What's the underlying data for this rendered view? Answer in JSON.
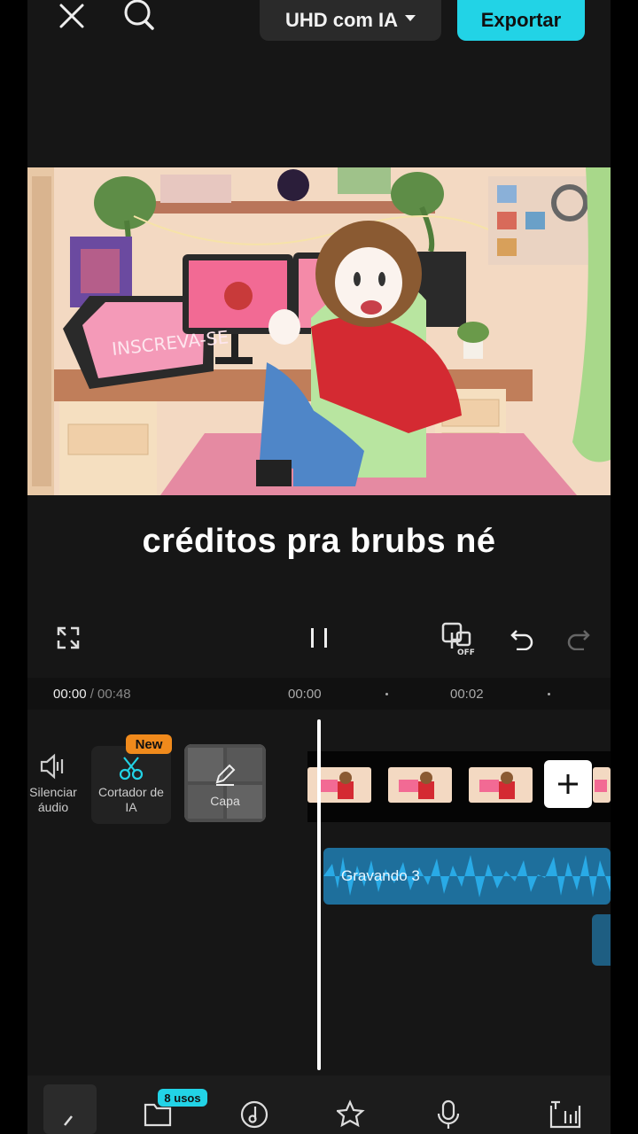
{
  "topbar": {
    "quality_label": "UHD com IA",
    "export_label": "Exportar"
  },
  "caption": {
    "text": "créditos pra brubs né"
  },
  "preview": {
    "tablet_text": "INSCREVA-SE"
  },
  "playback": {
    "current_time": "00:00",
    "total_time": "/ 00:48",
    "ruler_ticks": [
      "00:00",
      "00:02"
    ]
  },
  "timeline": {
    "mute_audio_label": "Silenciar áudio",
    "ai_cutter_label": "Cortador de IA",
    "new_badge": "New",
    "cover_label": "Capa",
    "audio_track_label": "Gravando 3"
  },
  "bottom_toolbar": {
    "usage_badge": "8 usos"
  },
  "colors": {
    "accent": "#22d3e6",
    "new_badge": "#f08a1c",
    "audio_clip": "#1e6f9c",
    "background": "#161616"
  },
  "icons": [
    "close-icon",
    "search-icon",
    "fullscreen-icon",
    "pause-icon",
    "keyframe-off-icon",
    "undo-icon",
    "redo-icon",
    "speaker-icon",
    "scissors-ai-icon",
    "pencil-icon",
    "plus-icon",
    "chevron-left-icon",
    "folder-icon",
    "music-icon",
    "star-effects-icon",
    "microphone-icon",
    "text-bars-icon"
  ]
}
